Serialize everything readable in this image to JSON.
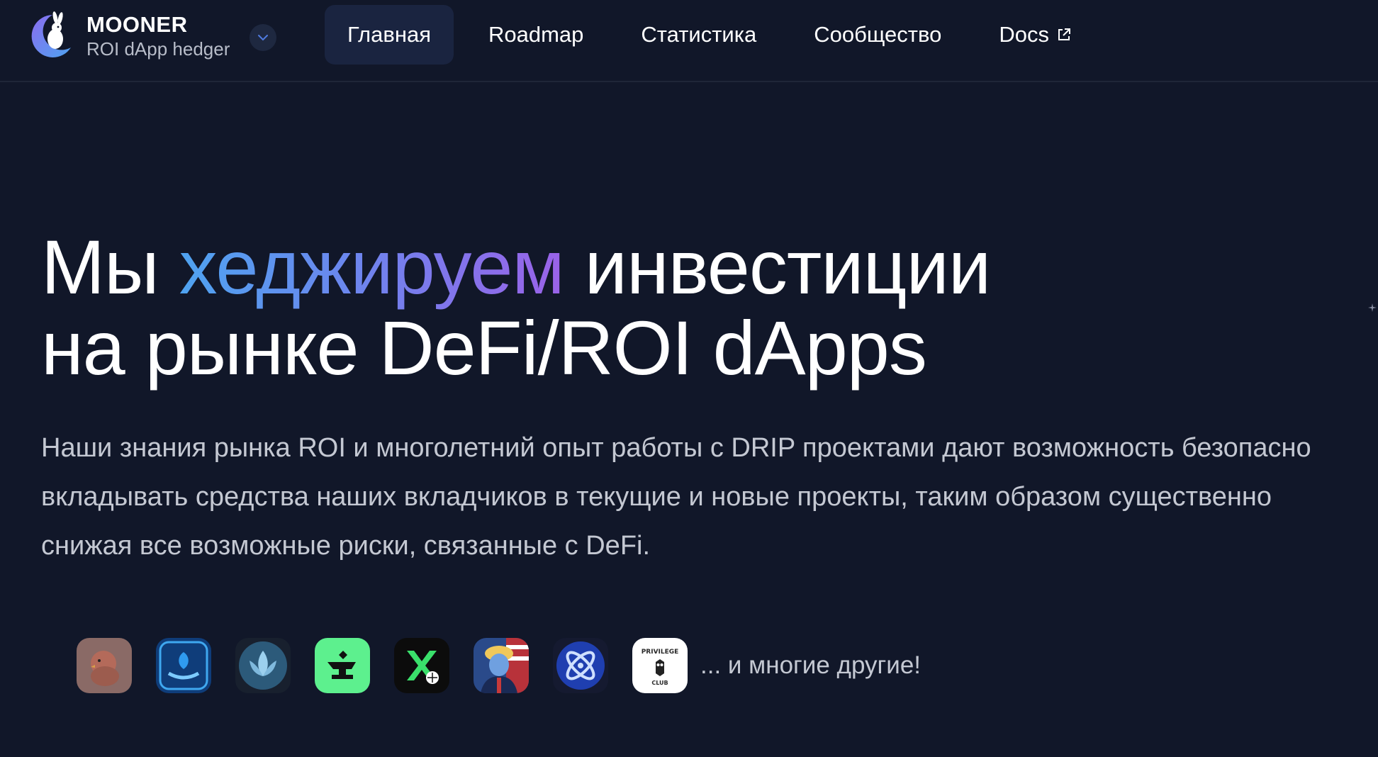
{
  "header": {
    "brand_name": "MOONER",
    "brand_subtitle": "ROI dApp hedger",
    "logo_icon": "moon-rabbit-logo",
    "toggle_icon": "chevron-down-icon",
    "nav": [
      {
        "label": "Главная",
        "active": true
      },
      {
        "label": "Roadmap",
        "active": false
      },
      {
        "label": "Статистика",
        "active": false
      },
      {
        "label": "Сообщество",
        "active": false
      },
      {
        "label": "Docs",
        "active": false,
        "icon": "external-link-icon"
      }
    ]
  },
  "hero": {
    "title_part1": "Мы ",
    "title_highlight": "хеджируем",
    "title_part2": " инвестиции",
    "title_line2": "на рынке DeFi/ROI dApps",
    "description": "Наши знания рынка ROI и многолетний опыт работы с DRIP проектами дают возможность безопасно вкладывать средства наших вкладчиков в текущие и новые проекты, таким образом существенно снижая все возможные риски, связанные с DeFi.",
    "more_text": "... и многие другие!",
    "project_icons": [
      "chicken-icon",
      "plant-hand-icon",
      "lotus-icon",
      "anvil-icon",
      "x-ball-icon",
      "trump-icon",
      "atom-icon",
      "privilege-club-icon"
    ],
    "privilege_text": "PRIVILEGE",
    "privilege_sub": "CLUB"
  },
  "colors": {
    "background": "#111729",
    "gradient_start": "#4fa3f0",
    "gradient_end": "#9a62e8",
    "nav_active_bg": "#1a2440"
  }
}
